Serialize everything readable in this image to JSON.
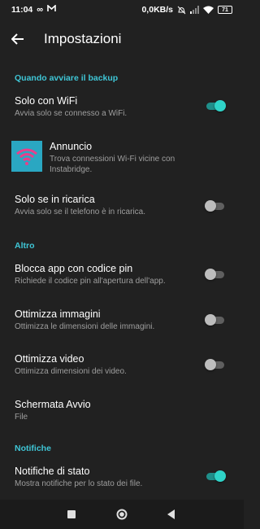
{
  "status_bar": {
    "time": "11:04",
    "left_icons": [
      "infinity-icon",
      "m-icon"
    ],
    "net_speed": "0,0KB/s",
    "battery": "71"
  },
  "app_bar": {
    "title": "Impostazioni"
  },
  "sections": {
    "backup": "Quando avviare il backup",
    "altro": "Altro",
    "notifiche": "Notifiche"
  },
  "prefs": {
    "wifi": {
      "title": "Solo con WiFi",
      "subtitle": "Avvia solo se connesso a WiFi.",
      "enabled": true
    },
    "ad": {
      "title": "Annuncio",
      "subtitle_line1": "Trova connessioni Wi-Fi vicine con",
      "subtitle_line2": "Instabridge."
    },
    "charging": {
      "title": "Solo se in ricarica",
      "subtitle": "Avvia solo se il telefono è in ricarica.",
      "enabled": false
    },
    "pin": {
      "title": "Blocca app con codice pin",
      "subtitle": "Richiede il codice pin all'apertura dell'app.",
      "enabled": false
    },
    "images": {
      "title": "Ottimizza immagini",
      "subtitle": "Ottimizza le dimensioni delle immagini.",
      "enabled": false
    },
    "video": {
      "title": "Ottimizza video",
      "subtitle": "Ottimizza dimensioni dei video.",
      "enabled": false
    },
    "startup": {
      "title": "Schermata Avvio",
      "subtitle": "File"
    },
    "status_notif": {
      "title": "Notifiche di stato",
      "subtitle": "Mostra notifiche per lo stato dei file.",
      "enabled": true
    }
  },
  "colors": {
    "background": "#212121",
    "accent": "#3fc6d6",
    "toggle_on": "#2fd3c8",
    "toggle_off": "#bdbdbd",
    "ad_icon_bg": "#2aa7c2"
  }
}
